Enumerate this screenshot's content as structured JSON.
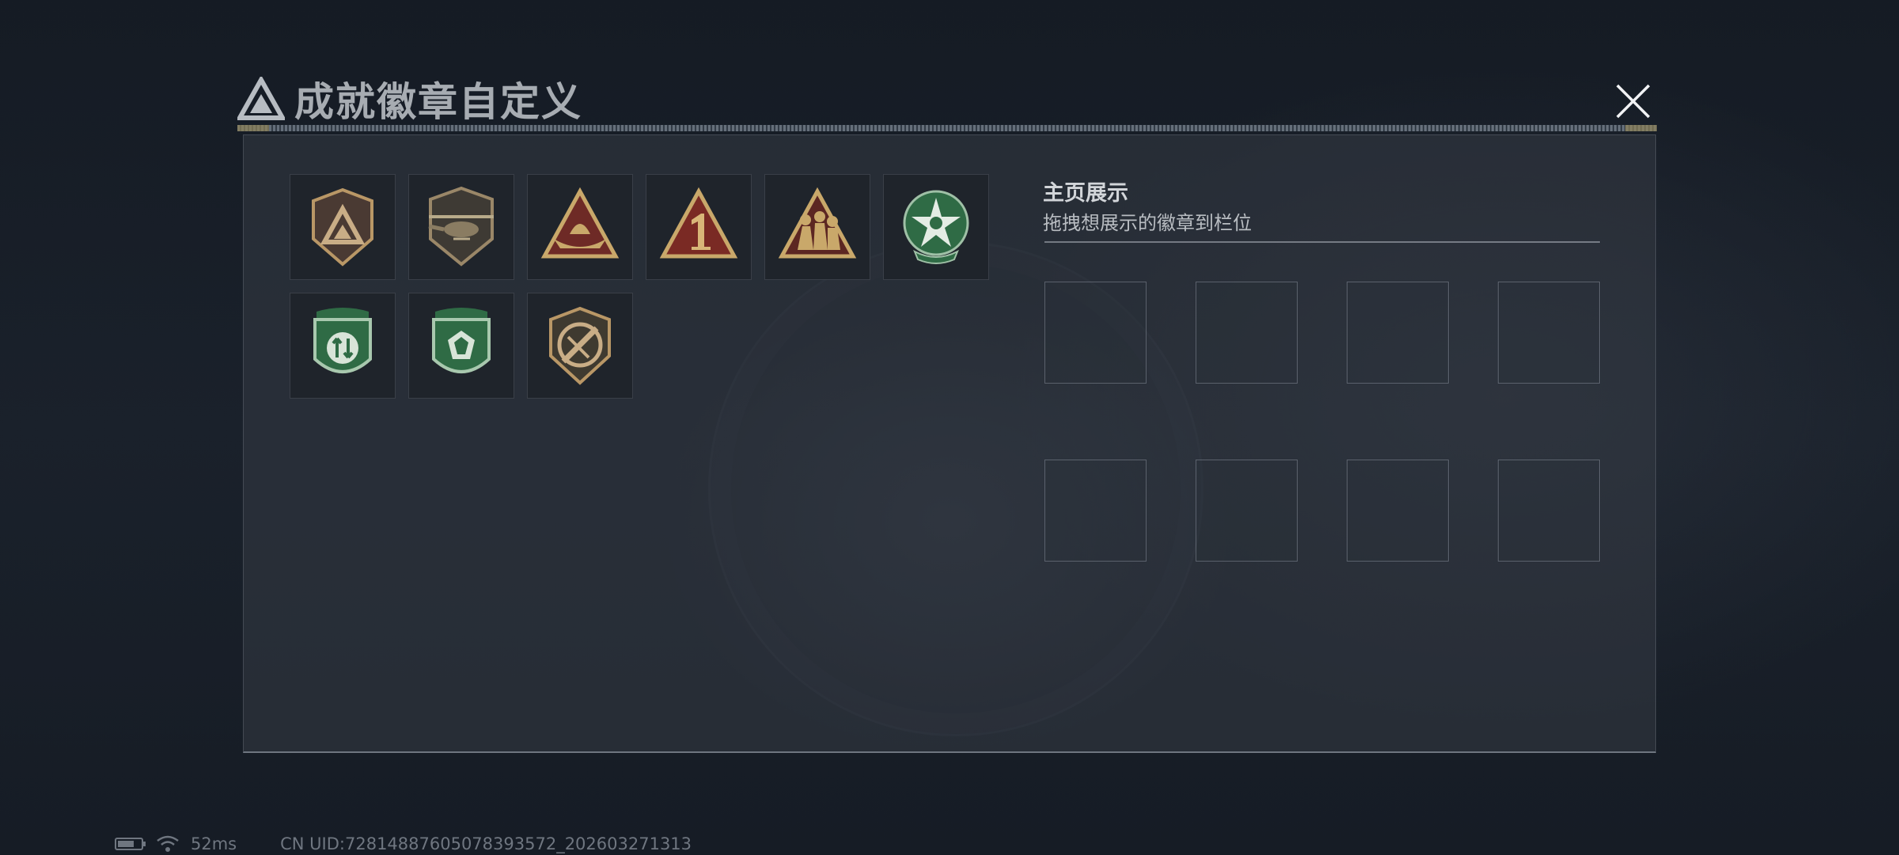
{
  "dialog": {
    "title": "成就徽章自定义"
  },
  "badges": [
    {
      "icon": "triangle-shield-badge-icon",
      "color": "#a98a5c"
    },
    {
      "icon": "helicopter-badge-icon",
      "color": "#9a8768"
    },
    {
      "icon": "boat-triangle-badge-icon",
      "color": "#c9a86a"
    },
    {
      "icon": "number-one-triangle-badge-icon",
      "color": "#c9a86a"
    },
    {
      "icon": "soldiers-triangle-badge-icon",
      "color": "#c9a86a"
    },
    {
      "icon": "green-star-medal-badge-icon",
      "color": "#3d7a52"
    },
    {
      "icon": "green-shield-arrows-badge-icon",
      "color": "#3d7a52"
    },
    {
      "icon": "green-shield-gem-badge-icon",
      "color": "#3d7a52"
    },
    {
      "icon": "knife-shield-badge-icon",
      "color": "#a98a5c"
    }
  ],
  "showcase": {
    "title": "主页展示",
    "subtitle": "拖拽想展示的徽章到栏位"
  },
  "status": {
    "ping": "52ms",
    "uid": "CN UID:728148876050783935​72_202603271313"
  }
}
